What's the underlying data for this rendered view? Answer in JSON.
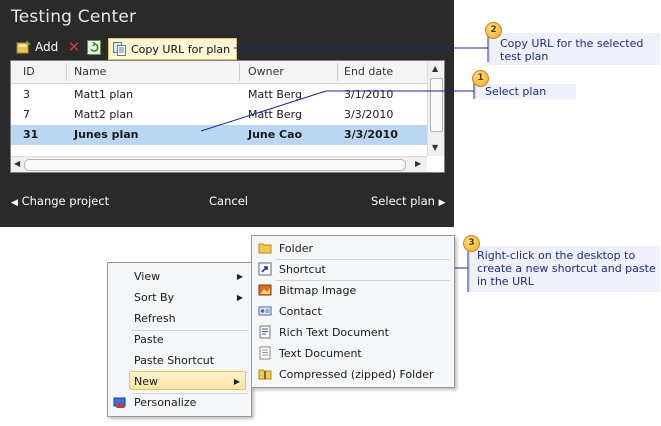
{
  "testing_center": {
    "title": "Testing Center",
    "toolbar": {
      "add_label": "Add",
      "copy_url_label": "Copy URL for plan"
    },
    "grid": {
      "columns": [
        "ID",
        "Name",
        "Owner",
        "End date"
      ],
      "rows": [
        {
          "id": "3",
          "name": "Matt1 plan",
          "owner": "Matt Berg",
          "end_date": "3/1/2010",
          "selected": false
        },
        {
          "id": "7",
          "name": "Matt2 plan",
          "owner": "Matt Berg",
          "end_date": "3/3/2010",
          "selected": false
        },
        {
          "id": "31",
          "name": "Junes plan",
          "owner": "June Cao",
          "end_date": "3/3/2010",
          "selected": true
        }
      ]
    },
    "nav": {
      "change_project": "Change project",
      "cancel": "Cancel",
      "select_plan": "Select plan"
    }
  },
  "callouts": [
    {
      "number": "2",
      "text": "Copy URL for the selected test plan"
    },
    {
      "number": "1",
      "text": "Select plan"
    },
    {
      "number": "3",
      "text": "Right-click on the desktop to create a new shortcut and paste in the URL"
    }
  ],
  "context_menu": {
    "items": [
      "View",
      "Sort By",
      "Refresh",
      "Paste",
      "Paste Shortcut",
      "New",
      "Personalize"
    ],
    "highlighted": "New"
  },
  "new_submenu": {
    "items": [
      "Folder",
      "Shortcut",
      "Bitmap Image",
      "Contact",
      "Rich Text Document",
      "Text Document",
      "Compressed (zipped) Folder"
    ]
  },
  "colors": {
    "panel_bg": "#2a2a2a",
    "selected_row": "#b9d7f3",
    "callout_text": "#1c2a8a",
    "menu_highlight": "#fde5a3"
  }
}
